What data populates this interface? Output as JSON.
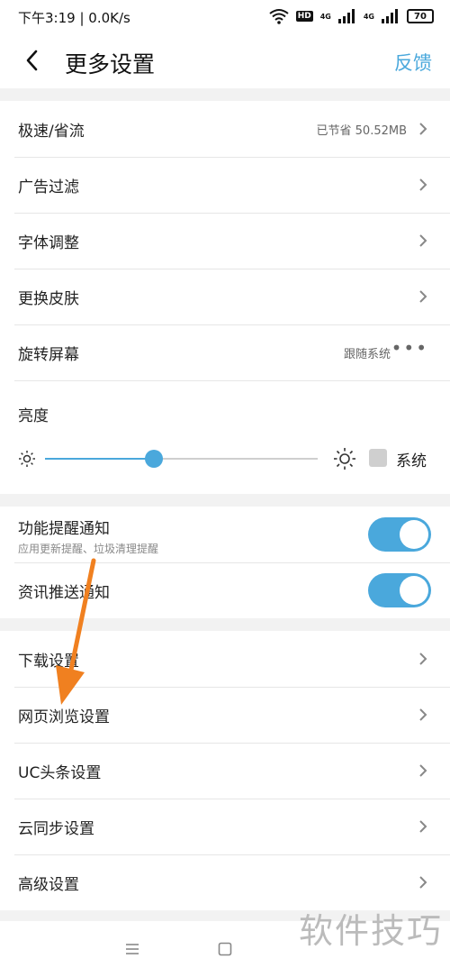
{
  "status_bar": {
    "time_speed": "下午3:19 | 0.0K/s",
    "hd": "HD",
    "net_label_1": "4G",
    "net_label_2": "4G",
    "battery": "70"
  },
  "header": {
    "title": "更多设置",
    "feedback": "反馈"
  },
  "group1": {
    "items": [
      {
        "label": "极速/省流",
        "value": "已节省 50.52MB"
      },
      {
        "label": "广告过滤"
      },
      {
        "label": "字体调整"
      },
      {
        "label": "更换皮肤"
      },
      {
        "label": "旋转屏幕",
        "value": "跟随系统"
      }
    ],
    "brightness": {
      "label": "亮度",
      "level": 0.4,
      "system_label": "系统",
      "system_checked": false
    }
  },
  "group2": {
    "items": [
      {
        "label": "功能提醒通知",
        "sub": "应用更新提醒、垃圾清理提醒",
        "on": true
      },
      {
        "label": "资讯推送通知",
        "on": true
      }
    ]
  },
  "group3": {
    "items": [
      {
        "label": "下载设置"
      },
      {
        "label": "网页浏览设置"
      },
      {
        "label": "UC头条设置"
      },
      {
        "label": "云同步设置"
      },
      {
        "label": "高级设置"
      }
    ]
  },
  "watermark": "软件技巧",
  "colors": {
    "accent": "#4aa8dc",
    "arrow": "#f08020"
  }
}
